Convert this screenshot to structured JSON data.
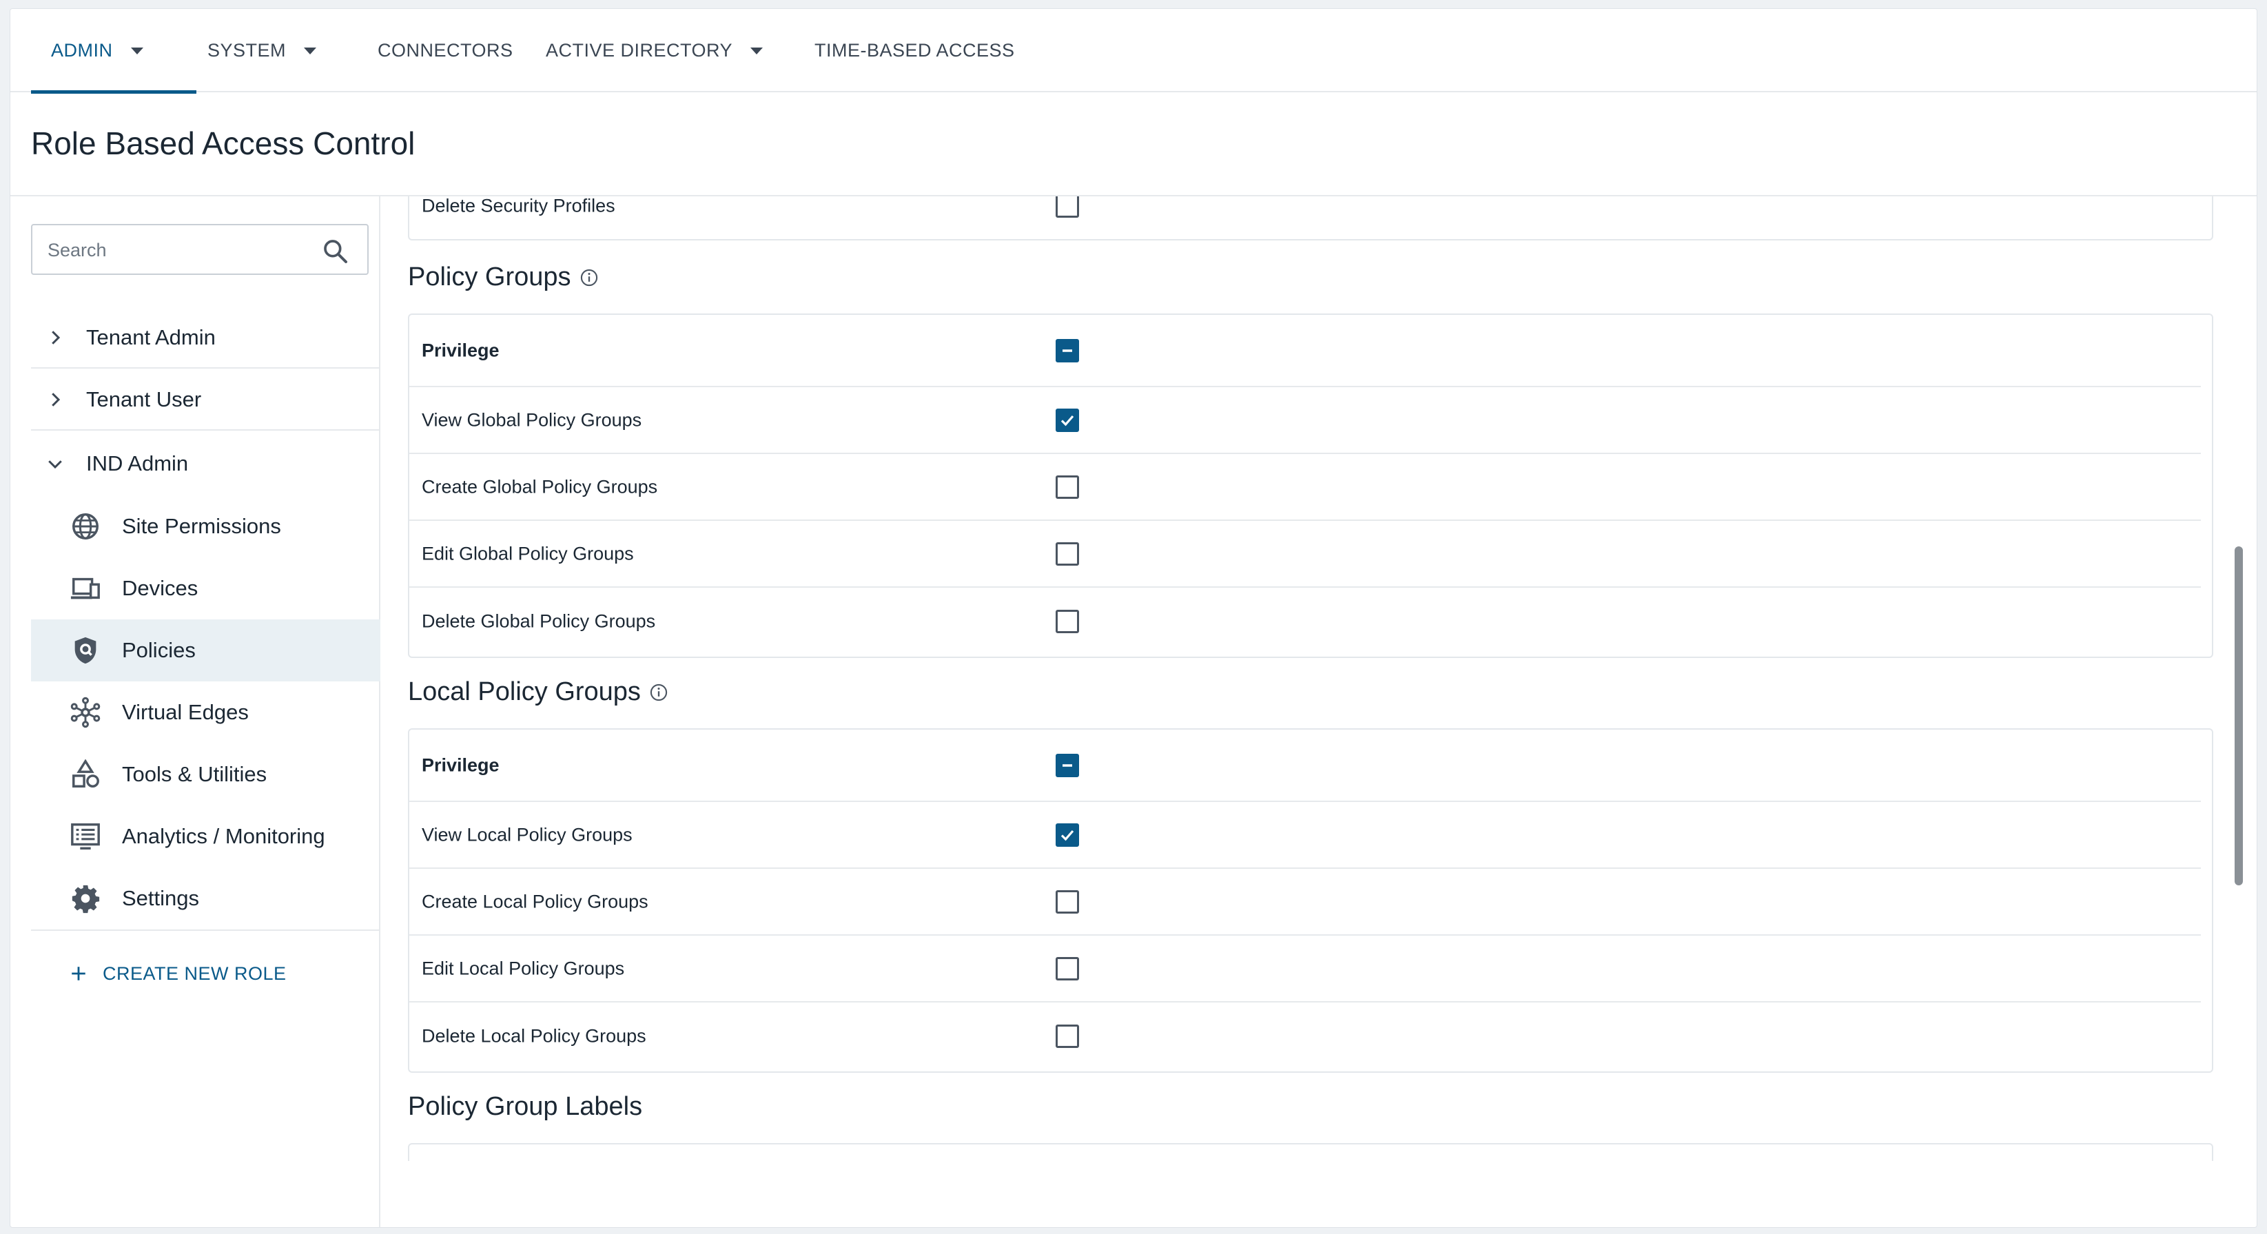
{
  "nav": {
    "tabs": [
      {
        "label": "ADMIN",
        "has_dropdown": true,
        "active": true
      },
      {
        "label": "SYSTEM",
        "has_dropdown": true
      },
      {
        "label": "CONNECTORS"
      },
      {
        "label": "ACTIVE DIRECTORY",
        "has_dropdown": true
      },
      {
        "label": "TIME-BASED ACCESS"
      }
    ]
  },
  "page": {
    "title": "Role Based Access Control"
  },
  "sidebar": {
    "search_placeholder": "Search",
    "tree": [
      {
        "label": "Tenant Admin",
        "expanded": false
      },
      {
        "label": "Tenant User",
        "expanded": false
      },
      {
        "label": "IND Admin",
        "expanded": true
      }
    ],
    "sub_items": [
      {
        "label": "Site Permissions",
        "icon": "globe-icon"
      },
      {
        "label": "Devices",
        "icon": "devices-icon"
      },
      {
        "label": "Policies",
        "icon": "policy-shield-icon",
        "selected": true
      },
      {
        "label": "Virtual Edges",
        "icon": "network-icon"
      },
      {
        "label": "Tools & Utilities",
        "icon": "shapes-icon"
      },
      {
        "label": "Analytics / Monitoring",
        "icon": "monitor-list-icon"
      },
      {
        "label": "Settings",
        "icon": "gear-icon"
      }
    ],
    "create_label": "CREATE NEW ROLE"
  },
  "content": {
    "partial_row": {
      "label": "Delete Security Profiles",
      "checked": false
    },
    "sections": [
      {
        "title": "Policy Groups",
        "has_info": true,
        "rows": [
          {
            "label": "Privilege",
            "state": "partial",
            "header": true
          },
          {
            "label": "View Global Policy Groups",
            "state": "checked"
          },
          {
            "label": "Create Global Policy Groups",
            "state": "unchecked"
          },
          {
            "label": "Edit Global Policy Groups",
            "state": "unchecked"
          },
          {
            "label": "Delete Global Policy Groups",
            "state": "unchecked"
          }
        ]
      },
      {
        "title": "Local Policy Groups",
        "has_info": true,
        "rows": [
          {
            "label": "Privilege",
            "state": "partial",
            "header": true
          },
          {
            "label": "View Local Policy Groups",
            "state": "checked"
          },
          {
            "label": "Create Local Policy Groups",
            "state": "unchecked"
          },
          {
            "label": "Edit Local Policy Groups",
            "state": "unchecked"
          },
          {
            "label": "Delete Local Policy Groups",
            "state": "unchecked"
          }
        ]
      },
      {
        "title": "Policy Group Labels",
        "has_info": false,
        "rows": []
      }
    ]
  },
  "colors": {
    "accent": "#0a5a8a",
    "selected_bg": "#e9f0f4",
    "border": "#e3e7eb"
  }
}
